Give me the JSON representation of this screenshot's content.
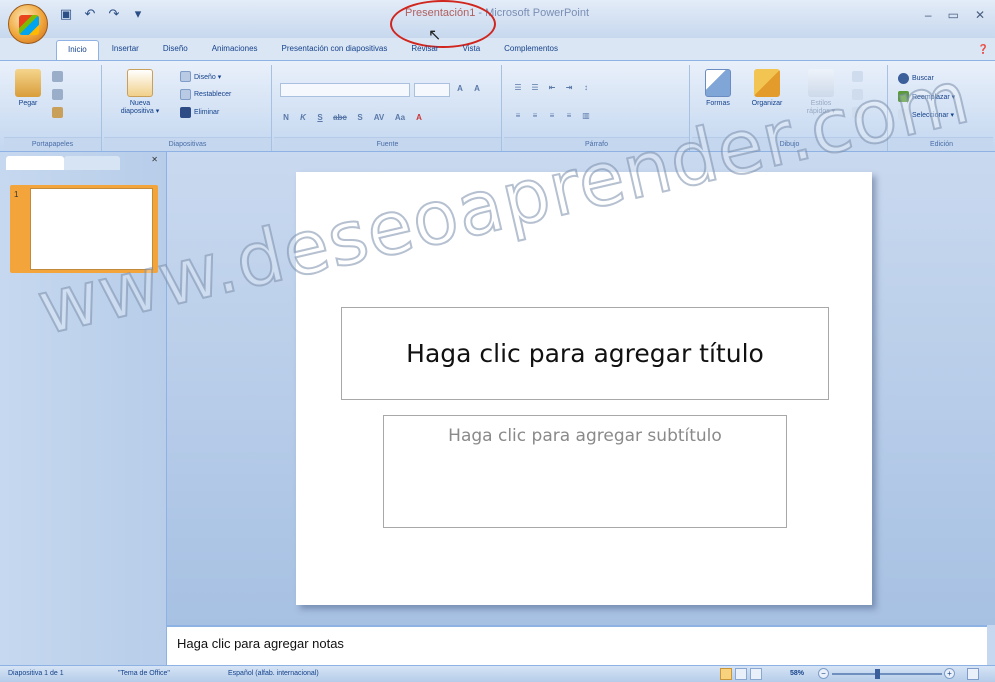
{
  "window": {
    "title_doc": "Presentación1",
    "title_app": " - Microsoft PowerPoint",
    "controls": [
      "–",
      "▭",
      "✕"
    ]
  },
  "tabs": [
    "Inicio",
    "Insertar",
    "Diseño",
    "Animaciones",
    "Presentación con diapositivas",
    "Revisar",
    "Vista",
    "Complementos"
  ],
  "active_tab": "Inicio",
  "ribbon": {
    "portapapeles": {
      "label": "Portapapeles",
      "pegar": "Pegar"
    },
    "diapositivas": {
      "label": "Diapositivas",
      "nueva_line1": "Nueva",
      "nueva_line2": "diapositiva ▾",
      "diseno": "Diseño ▾",
      "restablecer": "Restablecer",
      "eliminar": "Eliminar"
    },
    "fuente": {
      "label": "Fuente",
      "bold": "N",
      "italic": "K",
      "underline": "S",
      "strike": "abc",
      "shadow": "S",
      "spacing": "AV",
      "case": "Aa",
      "color": "A",
      "grow": "A",
      "shrink": "A"
    },
    "parrafo": {
      "label": "Párrafo"
    },
    "dibujo": {
      "label": "Dibujo",
      "formas": "Formas",
      "organizar": "Organizar",
      "estilos_line1": "Estilos",
      "estilos_line2": "rápidos ▾"
    },
    "edicion": {
      "label": "Edición",
      "buscar": "Buscar",
      "reemplazar": "Reemplazar ▾",
      "seleccionar": "Seleccionar ▾"
    }
  },
  "slide": {
    "title_placeholder": "Haga clic para agregar título",
    "subtitle_placeholder": "Haga clic para agregar subtítulo"
  },
  "thumbnail": {
    "number": "1"
  },
  "notes_placeholder": "Haga clic para agregar notas",
  "watermark": "www.deseoaprender.com",
  "status": {
    "slide": "Diapositiva 1 de 1",
    "theme": "\"Tema de Office\"",
    "language": "Español (alfab. internacional)",
    "zoom": "58%"
  },
  "colors": {
    "annotation": "#d0261e",
    "ribbon_bg": "#c3d7f0",
    "thumb_selected": "#f3a53b"
  }
}
